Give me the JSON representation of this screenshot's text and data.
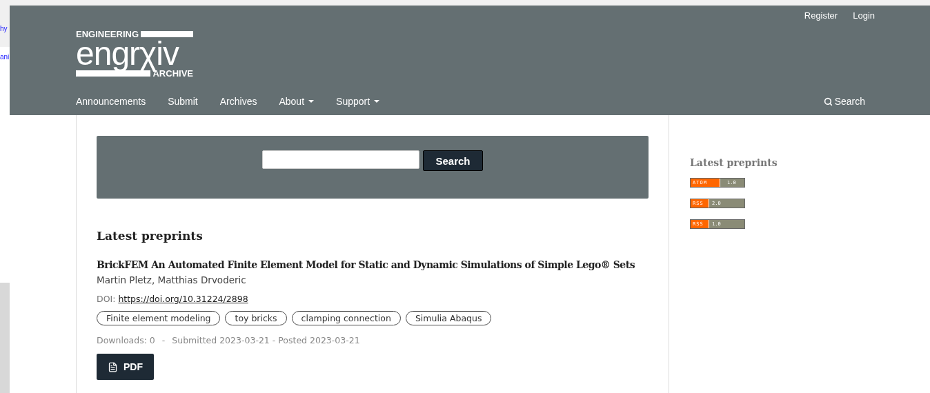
{
  "background_window": {
    "fragments": [
      "hy",
      "ani"
    ]
  },
  "header": {
    "logo": {
      "top": "ENGINEERING",
      "main": "engrχiv",
      "bottom": "ARCHIVE"
    },
    "user_links": [
      "Register",
      "Login"
    ],
    "nav": [
      {
        "label": "Announcements",
        "dropdown": false
      },
      {
        "label": "Submit",
        "dropdown": false
      },
      {
        "label": "Archives",
        "dropdown": false
      },
      {
        "label": "About",
        "dropdown": true
      },
      {
        "label": "Support",
        "dropdown": true
      }
    ],
    "search_link": "Search"
  },
  "search_panel": {
    "button": "Search"
  },
  "latest": {
    "heading": "Latest preprints",
    "items": [
      {
        "title": "BrickFEM An Automated Finite Element Model for Static and Dynamic Simulations of Simple Lego® Sets",
        "authors": "Martin Pletz, Matthias Drvoderic",
        "doi_label": "DOI:",
        "doi": "https://doi.org/10.31224/2898",
        "keywords": [
          "Finite element modeling",
          "toy bricks",
          "clamping connection",
          "Simulia Abaqus"
        ],
        "downloads": "Downloads: 0",
        "separator": "-",
        "dates": "Submitted 2023-03-21 - Posted 2023-03-21",
        "button": "PDF"
      }
    ]
  },
  "sidebar": {
    "heading": "Latest preprints",
    "feeds": [
      {
        "kind": "ATOM",
        "name": "ATOM",
        "version": "1.0"
      },
      {
        "kind": "RSS",
        "name": "RSS",
        "version": "2.0"
      },
      {
        "kind": "RSS",
        "name": "RSS",
        "version": "1.0"
      }
    ]
  }
}
